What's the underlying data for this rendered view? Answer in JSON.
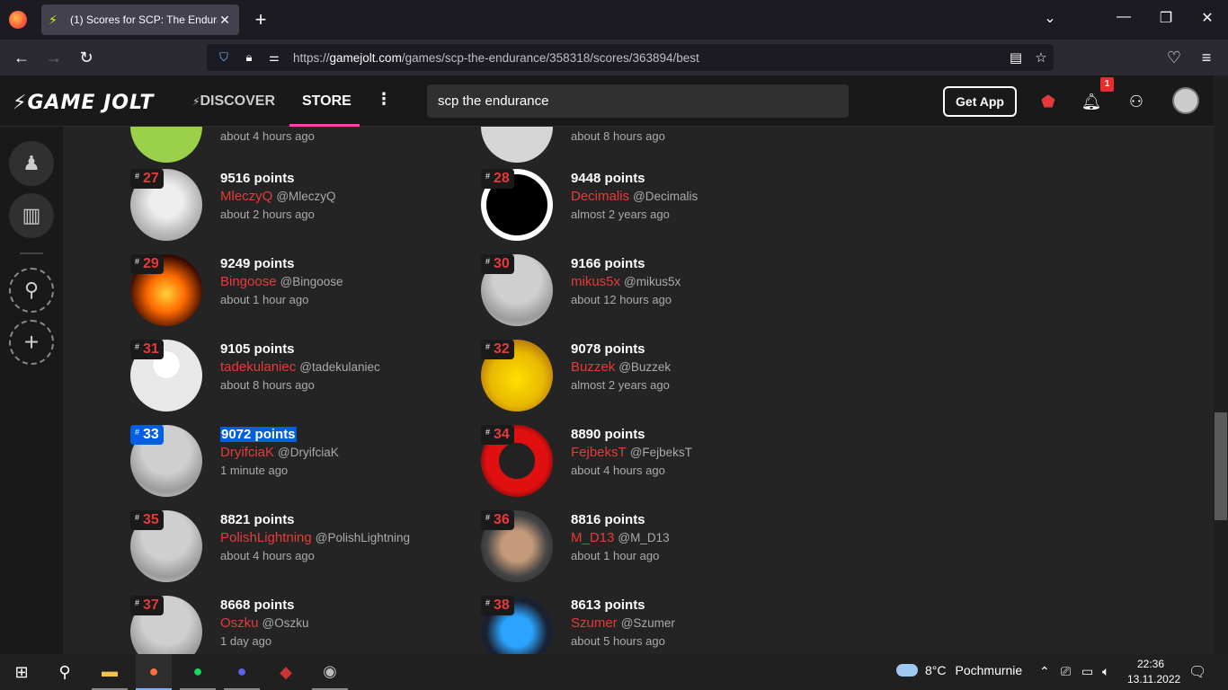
{
  "browser": {
    "tab_title": "(1) Scores for SCP: The Endurance",
    "url_prefix": "https://",
    "url_domain": "gamejolt.com",
    "url_path": "/games/scp-the-endurance/358318/scores/363894/best"
  },
  "site": {
    "logo": "GAME JOLT",
    "nav": {
      "discover": "DISCOVER",
      "store": "STORE"
    },
    "search_value": "scp the endurance",
    "get_app": "Get App",
    "notif_count": "1"
  },
  "scores": [
    {
      "rank": "27",
      "points": "9516 points",
      "user": "MleczyQ",
      "handle": "@MleczyQ",
      "when": "about 2 hours ago",
      "avatar": "anime-girl"
    },
    {
      "rank": "28",
      "points": "9448 points",
      "user": "Decimalis",
      "handle": "@Decimalis",
      "when": "almost 2 years ago",
      "avatar": "smile-face"
    },
    {
      "rank": "29",
      "points": "9249 points",
      "user": "Bingoose",
      "handle": "@Bingoose",
      "when": "about 1 hour ago",
      "avatar": "fire-r"
    },
    {
      "rank": "30",
      "points": "9166 points",
      "user": "mikus5x",
      "handle": "@mikus5x",
      "when": "about 12 hours ago",
      "avatar": "default-robot"
    },
    {
      "rank": "31",
      "points": "9105 points",
      "user": "tadekulaniec",
      "handle": "@tadekulaniec",
      "when": "about 8 hours ago",
      "avatar": "blank-person"
    },
    {
      "rank": "32",
      "points": "9078 points",
      "user": "Buzzek",
      "handle": "@Buzzek",
      "when": "almost 2 years ago",
      "avatar": "duck"
    },
    {
      "rank": "33",
      "points": "9072 points",
      "user": "DryifciaK",
      "handle": "@DryifciaK",
      "when": "1 minute ago",
      "avatar": "default-robot"
    },
    {
      "rank": "34",
      "points": "8890 points",
      "user": "FejbeksT",
      "handle": "@FejbeksT",
      "when": "about 4 hours ago",
      "avatar": "plague-doctor"
    },
    {
      "rank": "35",
      "points": "8821 points",
      "user": "PolishLightning",
      "handle": "@PolishLightning",
      "when": "about 4 hours ago",
      "avatar": "default-robot"
    },
    {
      "rank": "36",
      "points": "8816 points",
      "user": "M_D13",
      "handle": "@M_D13",
      "when": "about 1 hour ago",
      "avatar": "cartoon-dog"
    },
    {
      "rank": "37",
      "points": "8668 points",
      "user": "Oszku",
      "handle": "@Oszku",
      "when": "1 day ago",
      "avatar": "default-robot"
    },
    {
      "rank": "38",
      "points": "8613 points",
      "user": "Szumer",
      "handle": "@Szumer",
      "when": "about 5 hours ago",
      "avatar": "s-logo"
    }
  ],
  "partial_top": {
    "left_when": "about 4 hours ago",
    "right_when": "about 8 hours ago"
  },
  "taskbar": {
    "weather_temp": "8°C",
    "weather_desc": "Pochmurnie",
    "time": "22:36",
    "date": "13.11.2022",
    "notif": "1"
  }
}
